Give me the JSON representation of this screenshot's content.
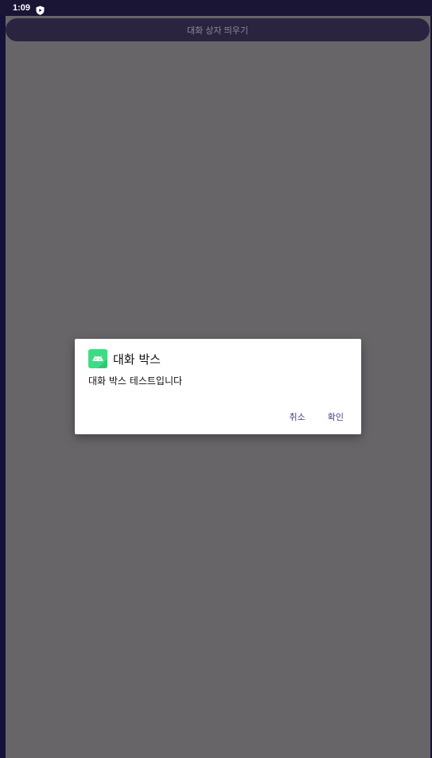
{
  "status_bar": {
    "time": "1:09",
    "icon": "shield-play-icon"
  },
  "top_button": {
    "label": "대화 상자 띄우기"
  },
  "dialog": {
    "icon": "android-icon",
    "title": "대화 박스",
    "message": "대화 박스 테스트입니다",
    "cancel_label": "취소",
    "confirm_label": "확인"
  },
  "colors": {
    "status_bar": "#1a1535",
    "scrim": "#676568",
    "top_button_bg": "#2b2441",
    "accent": "#4a3e8f",
    "app_icon_bg": "#3ddc84"
  }
}
